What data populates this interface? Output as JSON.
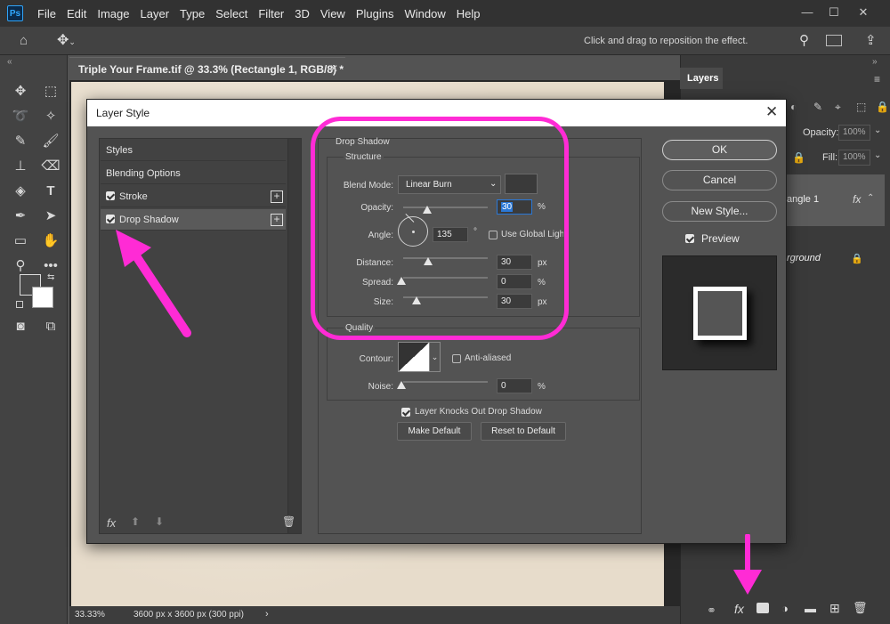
{
  "app": {
    "logo": "Ps"
  },
  "menu": [
    "File",
    "Edit",
    "Image",
    "Layer",
    "Type",
    "Select",
    "Filter",
    "3D",
    "View",
    "Plugins",
    "Window",
    "Help"
  ],
  "options_bar": {
    "hint": "Click and drag to reposition the effect."
  },
  "document": {
    "tab_title": "Triple Your Frame.tif @ 33.3% (Rectangle 1, RGB/8) *",
    "zoom": "33.33%",
    "size_info": "3600 px x 3600 px (300 ppi)"
  },
  "layers_panel": {
    "tab": "Layers",
    "opacity_label": "Opacity:",
    "opacity_value": "100%",
    "fill_label": "Fill:",
    "fill_value": "100%",
    "layers": [
      {
        "name": "angle 1",
        "fx": "fx"
      },
      {
        "name": "rground"
      }
    ]
  },
  "dialog": {
    "title": "Layer Style",
    "styles_list": [
      {
        "label": "Styles"
      },
      {
        "label": "Blending Options"
      },
      {
        "label": "Stroke",
        "checked": true
      },
      {
        "label": "Drop Shadow",
        "checked": true
      }
    ],
    "section_title": "Drop Shadow",
    "structure": {
      "title": "Structure",
      "blend_mode_label": "Blend Mode:",
      "blend_mode_value": "Linear Burn",
      "shadow_color": "#3a3a3a",
      "opacity_label": "Opacity:",
      "opacity_value": "30",
      "opacity_unit": "%",
      "angle_label": "Angle:",
      "angle_value": "135",
      "angle_unit": "°",
      "global_light_label": "Use Global Light",
      "distance_label": "Distance:",
      "distance_value": "30",
      "distance_unit": "px",
      "spread_label": "Spread:",
      "spread_value": "0",
      "spread_unit": "%",
      "size_label": "Size:",
      "size_value": "30",
      "size_unit": "px"
    },
    "quality": {
      "title": "Quality",
      "contour_label": "Contour:",
      "anti_aliased_label": "Anti-aliased",
      "noise_label": "Noise:",
      "noise_value": "0",
      "noise_unit": "%"
    },
    "knockout_label": "Layer Knocks Out Drop Shadow",
    "make_default": "Make Default",
    "reset_default": "Reset to Default",
    "buttons": {
      "ok": "OK",
      "cancel": "Cancel",
      "new_style": "New Style..."
    },
    "preview_label": "Preview",
    "bottom_icons": {
      "fx": "fx"
    }
  },
  "annotation_color": "#ff2bd5"
}
